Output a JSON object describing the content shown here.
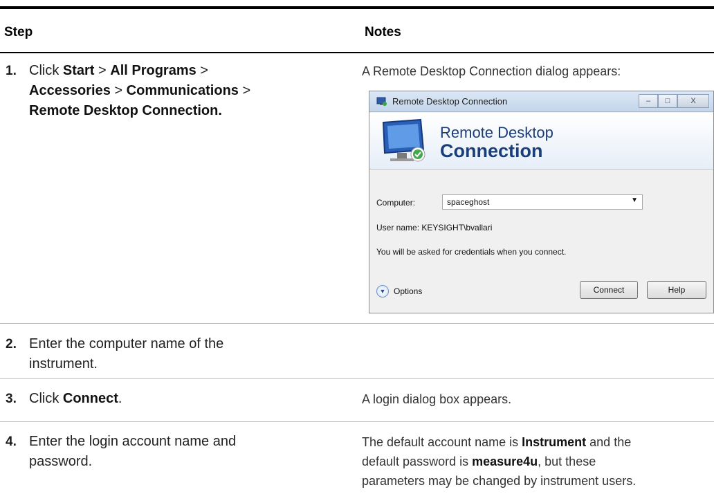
{
  "header": {
    "step": "Step",
    "notes": "Notes"
  },
  "rows": [
    {
      "num": "1.",
      "step_parts": [
        "Click ",
        "Start",
        " > ",
        "All Programs",
        " >",
        "Accessories",
        " > ",
        "Communications",
        " >",
        "Remote Desktop Connection."
      ],
      "note": "A Remote Desktop Connection dialog appears:"
    },
    {
      "num": "2.",
      "step_line1": "Enter the computer name of the",
      "step_line2": "instrument."
    },
    {
      "num": "3.",
      "step_prefix": "Click ",
      "step_bold": "Connect",
      "step_suffix": ".",
      "note": "A login dialog box appears."
    },
    {
      "num": "4.",
      "step_line1": "Enter the login account name and",
      "step_line2": "password.",
      "note_parts": [
        "The default account name is ",
        "Instrument",
        " and the",
        "default password is ",
        "measure4u",
        ", but these",
        "parameters may be changed by instrument users."
      ]
    }
  ],
  "dialog": {
    "title": "Remote Desktop Connection",
    "banner_line1": "Remote Desktop",
    "banner_line2": "Connection",
    "computer_label": "Computer:",
    "computer_value": "spaceghost",
    "username_text": "User name:  KEYSIGHT\\bvallari",
    "credentials_text": "You will be asked for credentials when you connect.",
    "options_label": "Options",
    "connect_label": "Connect",
    "help_label": "Help",
    "window_buttons": {
      "minimize": "–",
      "maximize": "□",
      "close": "X"
    }
  }
}
